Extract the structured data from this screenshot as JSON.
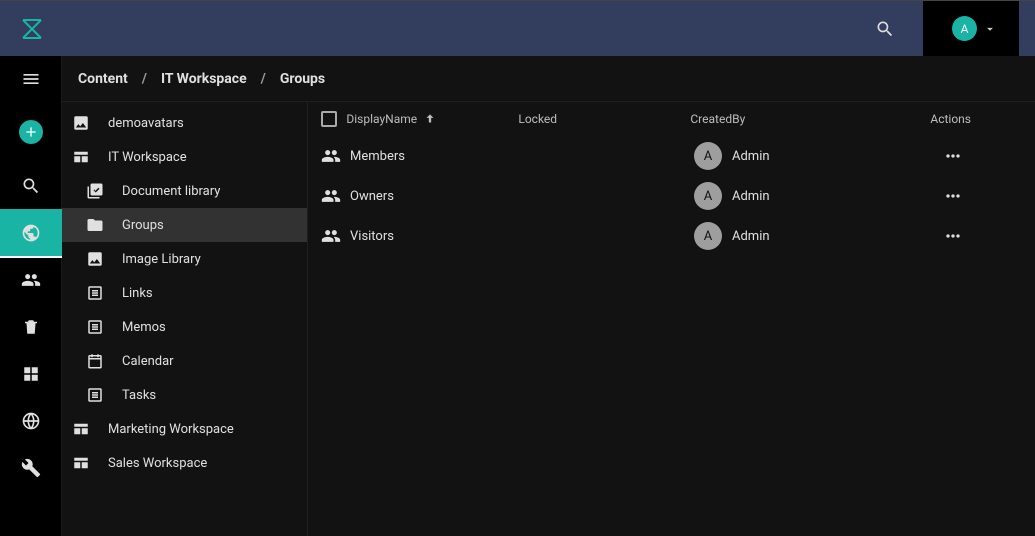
{
  "user_initial": "A",
  "breadcrumbs": [
    "Content",
    "IT Workspace",
    "Groups"
  ],
  "tree": {
    "items": [
      {
        "label": "demoavatars",
        "icon": "image",
        "level": 0,
        "active": false
      },
      {
        "label": "IT Workspace",
        "icon": "workspace",
        "level": 0,
        "active": false
      },
      {
        "label": "Document library",
        "icon": "doclib",
        "level": 1,
        "active": false
      },
      {
        "label": "Groups",
        "icon": "folder",
        "level": 1,
        "active": true
      },
      {
        "label": "Image Library",
        "icon": "image",
        "level": 1,
        "active": false
      },
      {
        "label": "Links",
        "icon": "list",
        "level": 1,
        "active": false
      },
      {
        "label": "Memos",
        "icon": "list",
        "level": 1,
        "active": false
      },
      {
        "label": "Calendar",
        "icon": "calendar",
        "level": 1,
        "active": false
      },
      {
        "label": "Tasks",
        "icon": "list",
        "level": 1,
        "active": false
      },
      {
        "label": "Marketing Workspace",
        "icon": "workspace",
        "level": 0,
        "active": false
      },
      {
        "label": "Sales Workspace",
        "icon": "workspace",
        "level": 0,
        "active": false
      }
    ]
  },
  "table": {
    "columns": {
      "display_name": "DisplayName",
      "locked": "Locked",
      "created_by": "CreatedBy",
      "actions": "Actions"
    },
    "rows": [
      {
        "name": "Members",
        "created_by_initial": "A",
        "created_by": "Admin"
      },
      {
        "name": "Owners",
        "created_by_initial": "A",
        "created_by": "Admin"
      },
      {
        "name": "Visitors",
        "created_by_initial": "A",
        "created_by": "Admin"
      }
    ]
  }
}
